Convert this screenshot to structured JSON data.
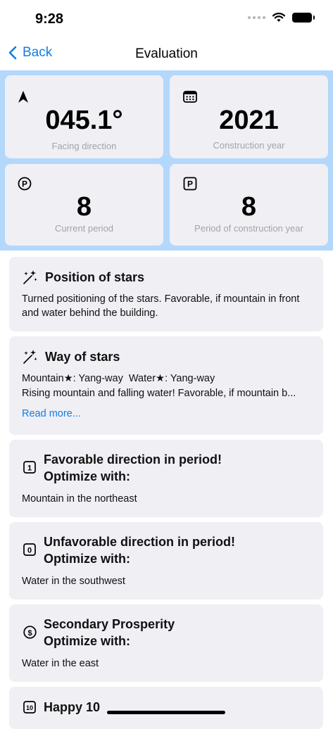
{
  "status_bar": {
    "time": "9:28"
  },
  "nav": {
    "back_label": "Back",
    "title": "Evaluation"
  },
  "stats": {
    "facing": {
      "value": "045.1°",
      "label": "Facing direction"
    },
    "construction_year": {
      "value": "2021",
      "label": "Construction year"
    },
    "current_period": {
      "value": "8",
      "label": "Current period"
    },
    "construction_period": {
      "value": "8",
      "label": "Period of construction year"
    }
  },
  "cards": {
    "position_of_stars": {
      "title": "Position of stars",
      "text": "Turned positioning of the stars. Favorable, if mountain in front and water behind the building."
    },
    "way_of_stars": {
      "title": "Way of stars",
      "line1": "Mountain★: Yang-way  Water★: Yang-way",
      "line2": "Rising mountain and falling water! Favorable, if mountain b...",
      "read_more": "Read more..."
    },
    "favorable": {
      "icon_number": "1",
      "title_line1": "Favorable direction in period!",
      "title_line2": "Optimize with:",
      "text": "Mountain in the northeast"
    },
    "unfavorable": {
      "icon_number": "0",
      "title_line1": "Unfavorable direction in period!",
      "title_line2": "Optimize with:",
      "text": "Water in the southwest"
    },
    "secondary": {
      "icon_symbol": "$",
      "title_line1": "Secondary Prosperity",
      "title_line2": "Optimize with:",
      "text": "Water in the east"
    },
    "happy10": {
      "icon_number": "10",
      "title": "Happy 10"
    }
  },
  "colors": {
    "accent": "#147ce5",
    "stats_background": "#b4d7fc",
    "card_background": "#efeff4",
    "label_gray": "#a3a3a8"
  },
  "icons": {
    "back": "chevron-left-icon",
    "facing": "location-arrow-icon",
    "year": "calendar-icon",
    "current_period": "circled-p-icon",
    "construction_period": "squared-p-icon",
    "stars": "sparkles-wand-icon"
  }
}
